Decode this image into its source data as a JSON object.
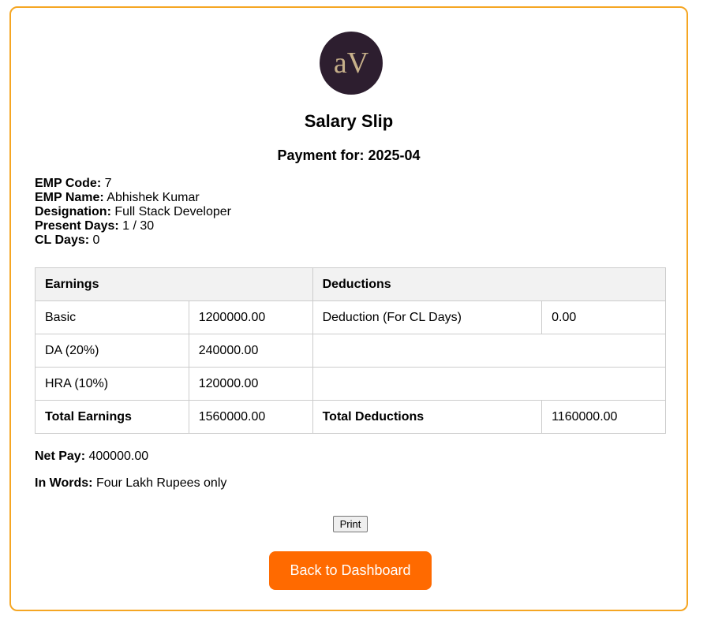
{
  "logo": {
    "text": "aV",
    "bg_color": "#2d1e2f",
    "text_color": "#c7b08a"
  },
  "title": "Salary Slip",
  "payment_label": "Payment for:",
  "payment_period": "2025-04",
  "employee": {
    "code_label": "EMP Code:",
    "code": "7",
    "name_label": "EMP Name:",
    "name": "Abhishek Kumar",
    "designation_label": "Designation:",
    "designation": "Full Stack Developer",
    "present_days_label": "Present Days:",
    "present_days": "1 / 30",
    "cl_days_label": "CL Days:",
    "cl_days": "0"
  },
  "table": {
    "earnings_header": "Earnings",
    "deductions_header": "Deductions",
    "rows": [
      {
        "earning": "Basic",
        "earning_amount": "1200000.00",
        "deduction": "Deduction (For CL Days)",
        "deduction_amount": "0.00"
      },
      {
        "earning": "DA (20%)",
        "earning_amount": "240000.00"
      },
      {
        "earning": "HRA (10%)",
        "earning_amount": "120000.00"
      }
    ],
    "total_earnings_label": "Total Earnings",
    "total_earnings": "1560000.00",
    "total_deductions_label": "Total Deductions",
    "total_deductions": "1160000.00"
  },
  "net_pay_label": "Net Pay:",
  "net_pay": "400000.00",
  "in_words_label": "In Words:",
  "in_words": "Four Lakh Rupees only",
  "buttons": {
    "print": "Print",
    "back": "Back to Dashboard"
  },
  "colors": {
    "card_border": "#f5a623",
    "back_button": "#ff6a00",
    "table_header_bg": "#f2f2f2"
  }
}
